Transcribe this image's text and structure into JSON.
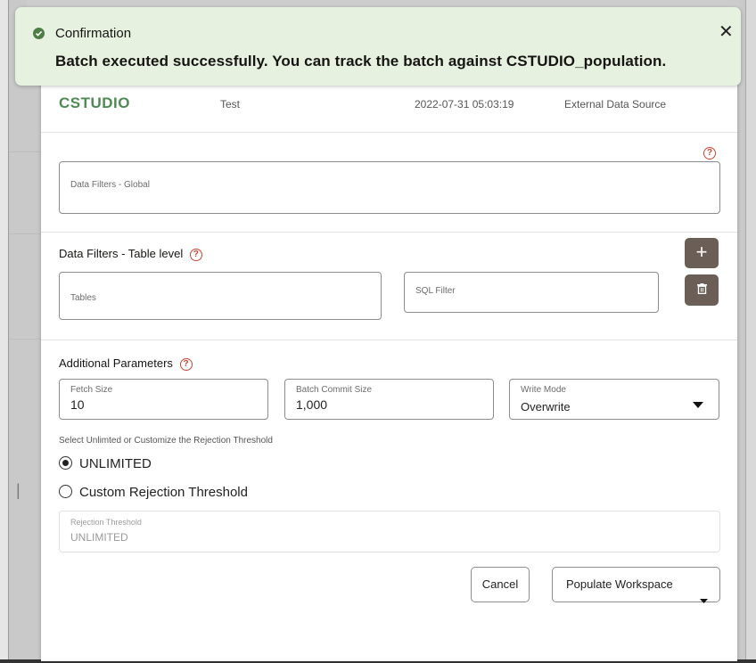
{
  "toast": {
    "title": "Confirmation",
    "message": "Batch executed successfully. You can track the batch against CSTUDIO_population.",
    "close_glyph": "✕",
    "accent": "#4b7d45"
  },
  "summary": {
    "name": "CSTUDIO",
    "description": "Test",
    "date": "2022-07-31 05:03:19",
    "type": "External Data Source"
  },
  "filters": {
    "global_label": "Data Filters - Global",
    "table_level_title": "Data Filters - Table level",
    "tables_label": "Tables",
    "sql_filter_label": "SQL Filter",
    "add_glyph": "+",
    "help_glyph": "?"
  },
  "params": {
    "title": "Additional Parameters",
    "fetch_size_label": "Fetch Size",
    "fetch_size_value": "10",
    "batch_commit_label": "Batch Commit Size",
    "batch_commit_value": "1,000",
    "write_mode_label": "Write Mode",
    "write_mode_value": "Overwrite"
  },
  "rejection": {
    "prompt": "Select Unlimted or Customize the Rejection Threshold",
    "option_unlimited": "UNLIMITED",
    "option_custom": "Custom Rejection Threshold",
    "selected": "UNLIMITED",
    "threshold_label": "Rejection Threshold",
    "threshold_value": "UNLIMITED"
  },
  "actions": {
    "cancel": "Cancel",
    "populate": "Populate Workspace"
  },
  "colors": {
    "brand_green": "#4f8a55",
    "toast_bg": "#e6f1df",
    "help_red": "#c74634",
    "icon_button": "#6b5e57"
  }
}
